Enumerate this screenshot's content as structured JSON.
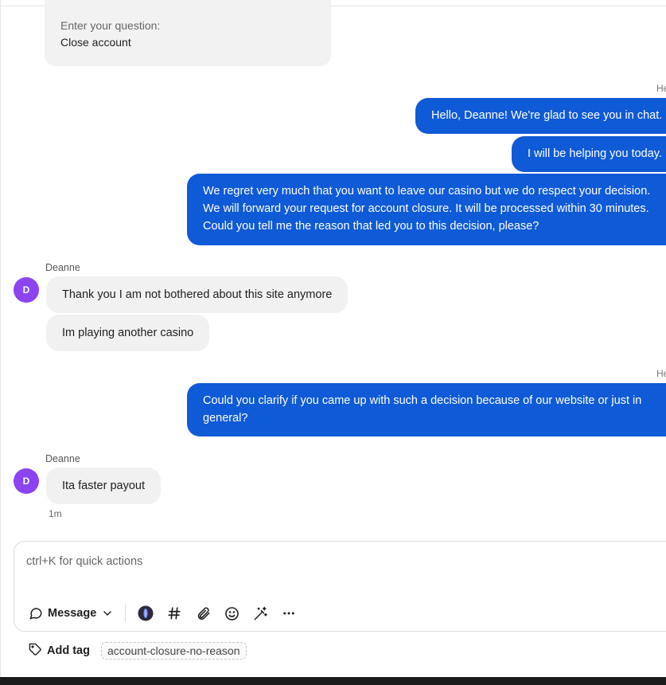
{
  "form": {
    "label": "Enter your question:",
    "value": "Close account"
  },
  "agent_sender_cut": "He",
  "messages_agent_1": [
    "Hello, Deanne! We're glad to see you in chat.",
    "I will be helping you today.",
    "We regret very much that you want to leave our casino but we do respect your decision.",
    "We will forward your request for account closure. It will be processed within 30 minutes.",
    "Could you tell me the reason that led you to this decision, please?"
  ],
  "user_group_1": {
    "author": "Deanne",
    "avatar_initial": "D",
    "messages": [
      "Thank you I am not bothered about this site anymore",
      "Im playing another casino"
    ]
  },
  "messages_agent_2": [
    "Could you clarify if you came up with such a decision because of our website or just in",
    "general?"
  ],
  "user_group_2": {
    "author": "Deanne",
    "avatar_initial": "D",
    "messages": [
      "Ita faster payout"
    ],
    "timestamp": "1m"
  },
  "composer": {
    "placeholder": "ctrl+K for quick actions",
    "value": "",
    "message_type_label": "Message",
    "tools": [
      "ai-assist-icon",
      "hashtag-icon",
      "paperclip-icon",
      "emoji-icon",
      "magic-wand-icon",
      "more-icon"
    ]
  },
  "tags": {
    "add_label": "Add tag",
    "items": [
      "account-closure-no-reason"
    ]
  },
  "colors": {
    "agent_bubble": "#0f5ad6",
    "user_bubble": "#f1f1f1",
    "avatar": "#8b44f0"
  }
}
